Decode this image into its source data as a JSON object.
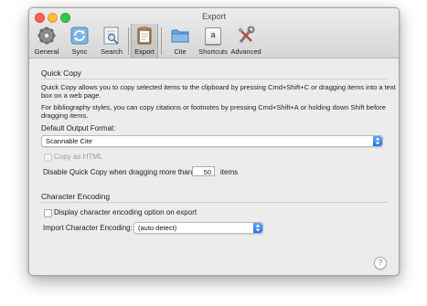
{
  "window": {
    "title": "Export"
  },
  "toolbar": {
    "items": [
      {
        "label": "General"
      },
      {
        "label": "Sync"
      },
      {
        "label": "Search"
      },
      {
        "label": "Export"
      },
      {
        "label": "Cite"
      },
      {
        "label": "Shortcuts"
      },
      {
        "label": "Advanced"
      }
    ],
    "shortcut_key": "a"
  },
  "quick_copy": {
    "title": "Quick Copy",
    "desc_line1": "Quick Copy allows you to copy selected items to the clipboard by pressing Cmd+Shift+C or dragging items into a text",
    "desc_line2": "box on a web page.",
    "bib_line1": "For bibliography styles, you can copy citations or footnotes by pressing Cmd+Shift+A or holding down Shift before",
    "bib_line2": "dragging items.",
    "default_format_label": "Default Output Format:",
    "default_format_value": "Scannable Cite",
    "copy_as_html_label": "Copy as HTML",
    "disable_label": "Disable Quick Copy when dragging more than",
    "disable_value": "50",
    "disable_unit": "items"
  },
  "character_encoding": {
    "title": "Character Encoding",
    "display_option_label": "Display character encoding option on export",
    "import_label": "Import Character Encoding:",
    "import_value": "(auto detect)"
  },
  "help": {
    "label": "?"
  }
}
